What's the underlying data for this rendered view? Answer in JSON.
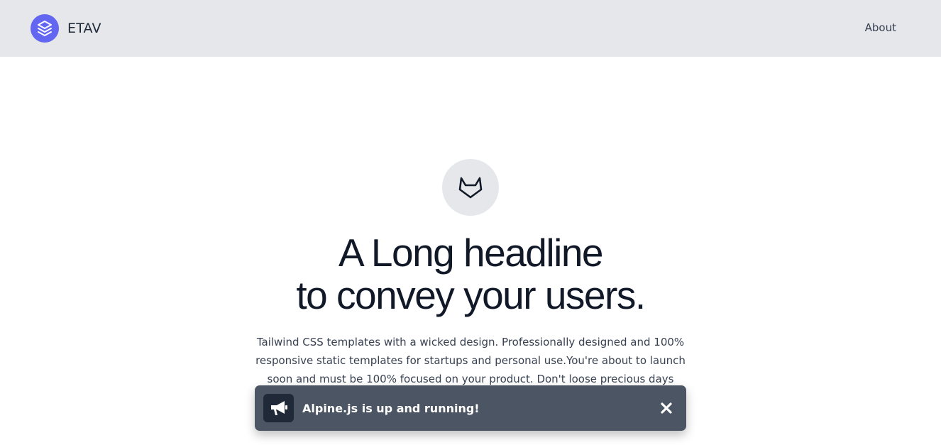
{
  "header": {
    "brand_name": "ETAV",
    "brand_icon": "layers-icon",
    "nav": [
      {
        "label": "About"
      }
    ],
    "colors": {
      "background": "#e5e7eb",
      "brand_accent": "#6366f1"
    }
  },
  "hero": {
    "icon": "gitlab-fox-icon",
    "headline_line1": "A Long headline",
    "headline_line2": "to convey your users.",
    "description": "Tailwind CSS templates with a wicked design. Professionally designed and 100% responsive static templates for startups and personal use.You're about to launch soon and must be 100% focused on your product. Don't loose precious days designing, c"
  },
  "toast": {
    "icon": "megaphone-icon",
    "message": "Alpine.js is up and running!",
    "close_icon": "close-icon",
    "colors": {
      "background": "#4b5563",
      "icon_background": "#1f2937"
    }
  }
}
